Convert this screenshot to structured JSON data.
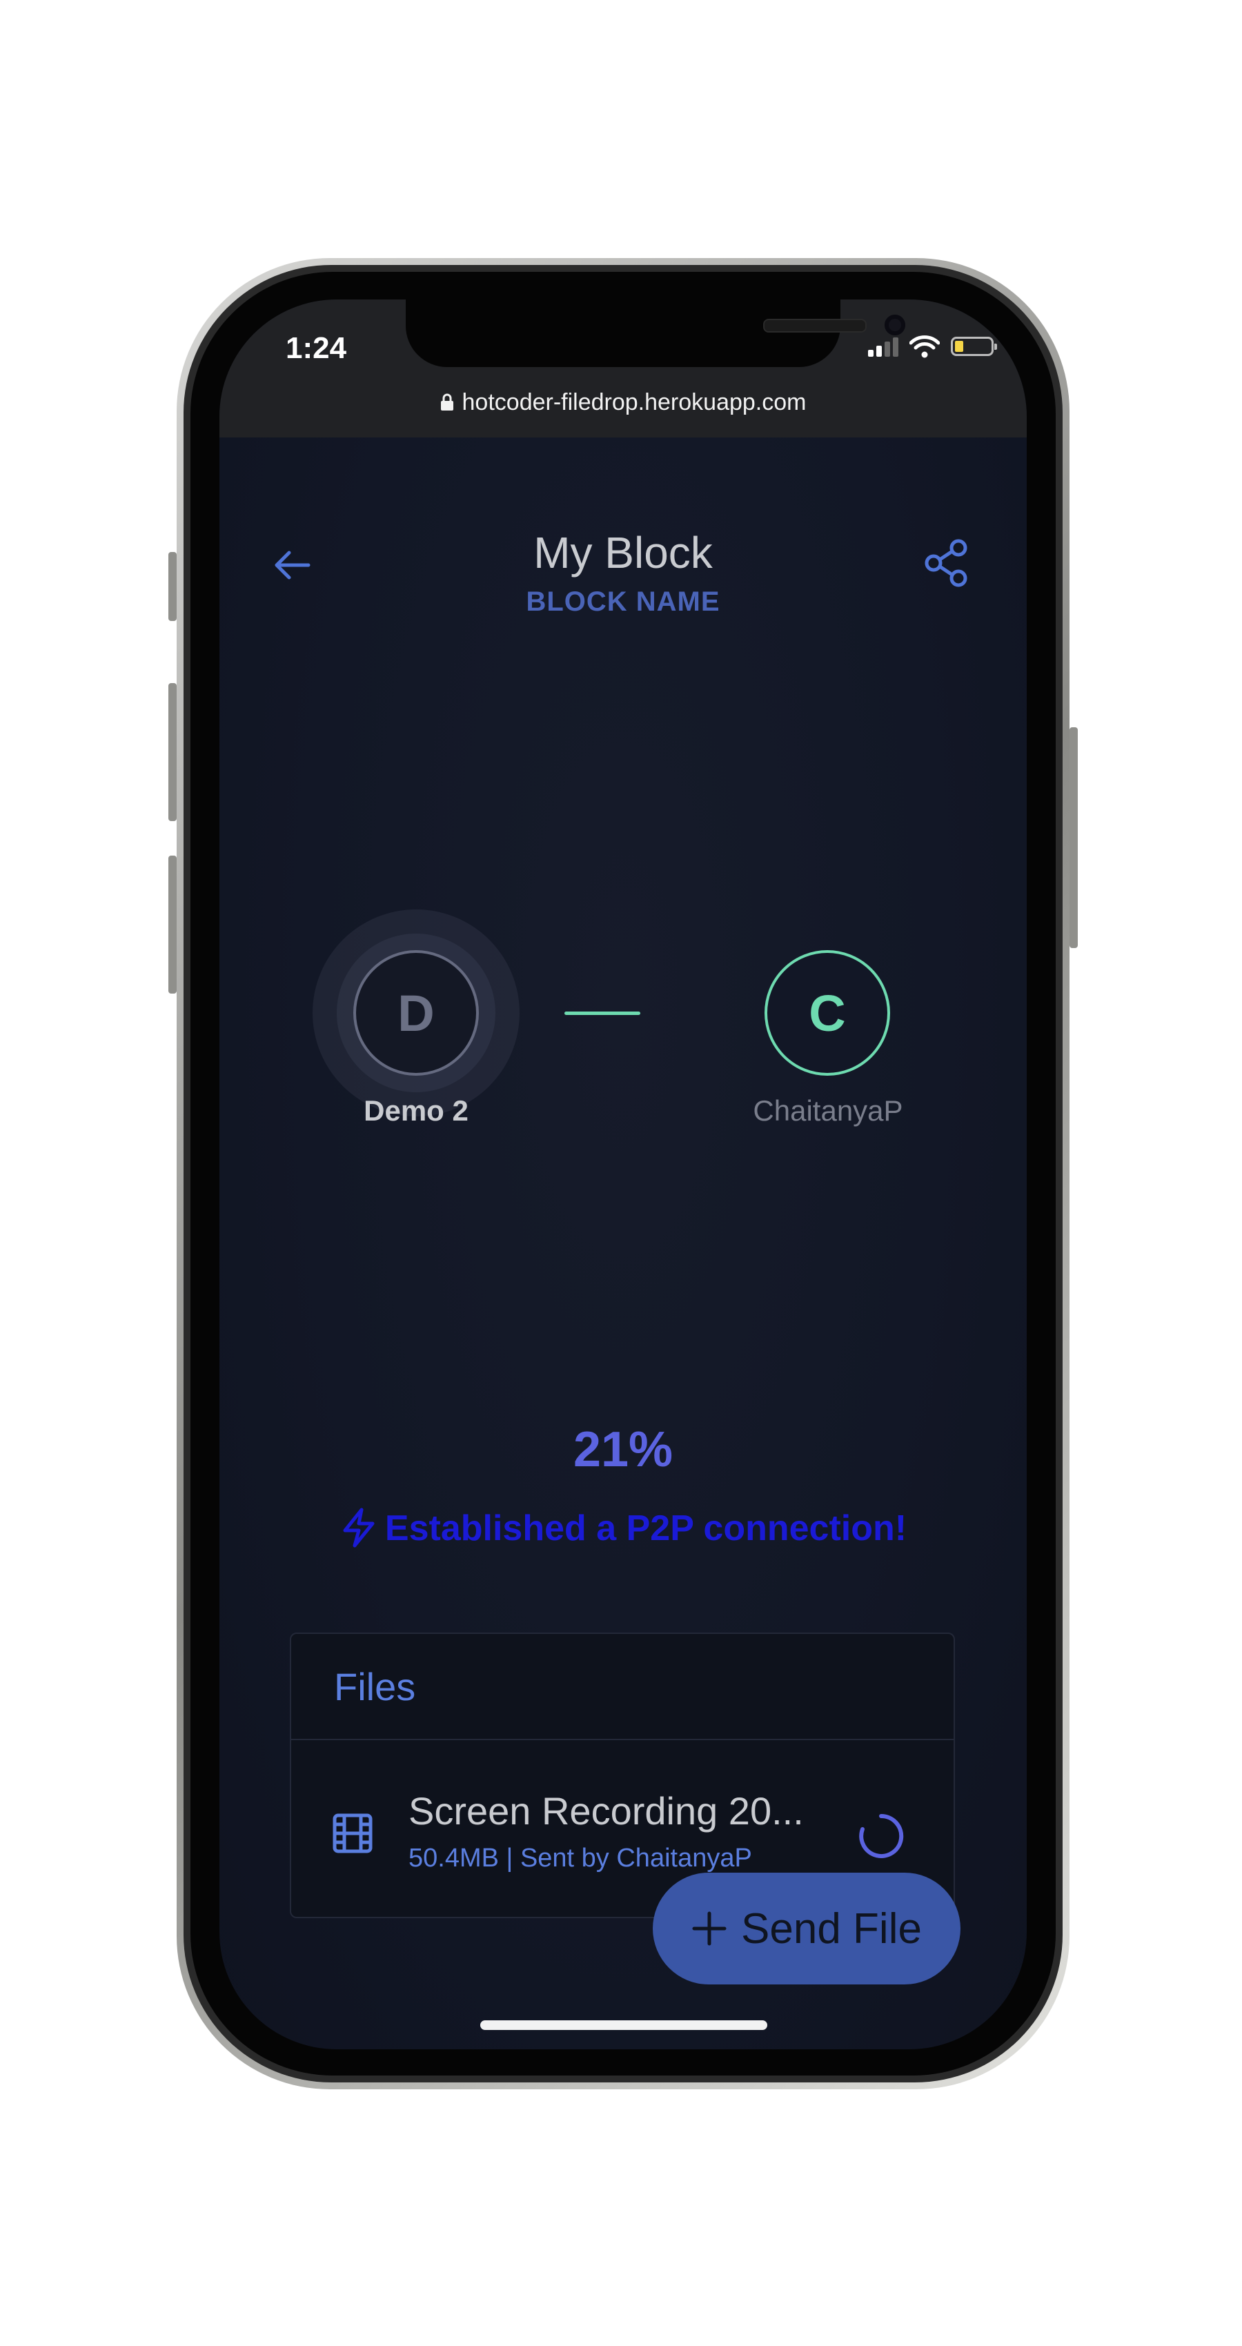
{
  "status_bar": {
    "time": "1:24"
  },
  "browser": {
    "url": "hotcoder-filedrop.herokuapp.com"
  },
  "header": {
    "title": "My Block",
    "subtitle": "BLOCK NAME"
  },
  "peers": {
    "left": {
      "initial": "D",
      "name": "Demo 2"
    },
    "right": {
      "initial": "C",
      "name": "ChaitanyaP"
    }
  },
  "transfer": {
    "progress_text": "21%",
    "progress": 0.21,
    "status": "Established a P2P connection!"
  },
  "files": {
    "heading": "Files",
    "items": [
      {
        "name": "Screen Recording 20...",
        "meta": "50.4MB | Sent by ChaitanyaP"
      }
    ]
  },
  "send_button": {
    "label": "Send File"
  },
  "colors": {
    "accent": "#5b7fe0",
    "connected": "#6edbb0",
    "status": "#1a1ad6",
    "background": "#121726"
  }
}
